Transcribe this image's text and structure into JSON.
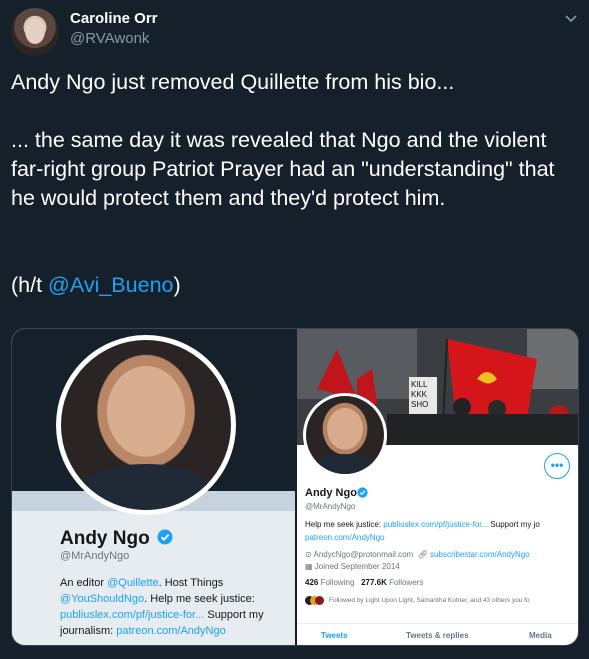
{
  "tweet": {
    "author_name": "Caroline Orr",
    "author_handle": "@RVAwonk",
    "line1": "Andy Ngo just removed Quillette from his bio...",
    "line2": "... the same day it was revealed that Ngo and the violent far-right group Patriot Prayer had an \"understanding\" that he would protect them and they'd protect him.",
    "line3_prefix": "(h/t ",
    "line3_mention": "@Avi_Bueno",
    "line3_suffix": ")"
  },
  "left_profile": {
    "name": "Andy Ngo",
    "handle": "@MrAndyNgo",
    "bio_part1": "An editor ",
    "bio_link1": "@Quillette",
    "bio_part2": ". Host Things ",
    "bio_link2": "@YouShouldNgo",
    "bio_part3": ". Help me seek justice: ",
    "bio_link3": "publiuslex.com/pf/justice-for...",
    "bio_part4": " Support my journalism: ",
    "bio_link4": "patreon.com/AndyNgo"
  },
  "right_profile": {
    "name": "Andy Ngo",
    "handle": "@MrAndyNgo",
    "more_label": "•••",
    "bio_prefix": "Help me seek justice: ",
    "bio_link1": "publiuslex.com/pf/justice-for...",
    "bio_middle": " Support my jo",
    "bio_link2": "patreon.com/AndyNgo",
    "email": "AndycNgo@protonmail.com",
    "website": "subscribestar.com/AndyNgo",
    "joined": "Joined September 2014",
    "following_count": "426",
    "following_label": "Following",
    "followers_count": "277.6K",
    "followers_label": "Followers",
    "followed_by": "Followed by Light Upon Light, Samantha Kutner, and 43 others you fo",
    "tabs": [
      "Tweets",
      "Tweets & replies",
      "Media"
    ],
    "banner_sign": "KILL\nKKK\nSHO"
  },
  "colors": {
    "background": "#15202b",
    "link": "#1da1f2",
    "muted": "#8899a6"
  }
}
